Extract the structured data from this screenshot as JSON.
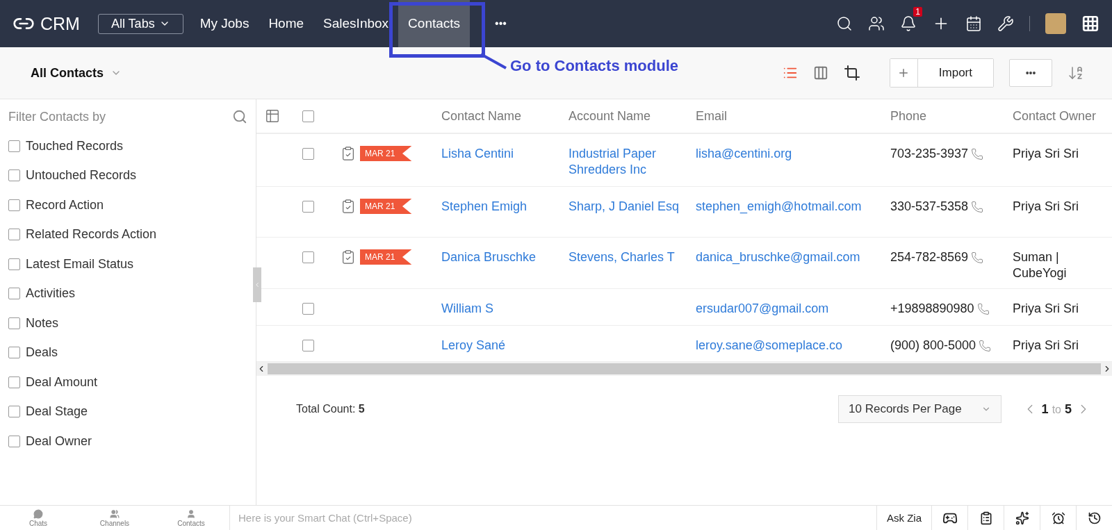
{
  "nav": {
    "logo": "CRM",
    "all_tabs": "All Tabs",
    "tabs": [
      {
        "label": "My Jobs",
        "selected": false
      },
      {
        "label": "Home",
        "selected": false
      },
      {
        "label": "SalesInbox",
        "selected": false
      },
      {
        "label": "Contacts",
        "selected": true
      }
    ],
    "more": "•••",
    "notification_count": "1"
  },
  "annotation": {
    "text": "Go to Contacts module"
  },
  "toolbar": {
    "view": "All Contacts",
    "view_modes": [
      {
        "kind": "list",
        "selected": true
      },
      {
        "kind": "kanban",
        "selected": false
      }
    ],
    "import": "Import",
    "more": "•••"
  },
  "sidebar": {
    "title": "Filter Contacts by",
    "filters": [
      {
        "label": "Touched Records",
        "checked": false
      },
      {
        "label": "Untouched Records",
        "checked": false
      },
      {
        "label": "Record Action",
        "checked": false
      },
      {
        "label": "Related Records Action",
        "checked": false
      },
      {
        "label": "Latest Email Status",
        "checked": false
      },
      {
        "label": "Activities",
        "checked": false
      },
      {
        "label": "Notes",
        "checked": false
      },
      {
        "label": "Deals",
        "checked": false
      },
      {
        "label": "Deal Amount",
        "checked": false
      },
      {
        "label": "Deal Stage",
        "checked": false
      },
      {
        "label": "Deal Owner",
        "checked": false
      }
    ]
  },
  "table": {
    "select_all_checked": false,
    "columns": [
      "Contact Name",
      "Account Name",
      "Email",
      "Phone",
      "Contact Owner"
    ],
    "rows": [
      {
        "checked": false,
        "has_task": true,
        "tag": "MAR 21",
        "contact_name": "Lisha Centini",
        "account_name": "Industrial Paper Shredders Inc",
        "email": "lisha@centini.org",
        "phone": "703-235-3937",
        "owner": "Priya Sri Sri"
      },
      {
        "checked": false,
        "has_task": true,
        "tag": "MAR 21",
        "contact_name": "Stephen Emigh",
        "account_name": "Sharp, J Daniel Esq",
        "email": "stephen_emigh@hotmail.com",
        "phone": "330-537-5358",
        "owner": "Priya Sri Sri"
      },
      {
        "checked": false,
        "has_task": true,
        "tag": "MAR 21",
        "contact_name": "Danica Bruschke",
        "account_name": "Stevens, Charles T",
        "email": "danica_bruschke@gmail.com",
        "phone": "254-782-8569",
        "owner": "Suman | CubeYogi"
      },
      {
        "checked": false,
        "has_task": false,
        "contact_name": "William S",
        "email": "ersudar007@gmail.com",
        "phone": "+19898890980",
        "owner": "Priya Sri Sri"
      },
      {
        "checked": false,
        "has_task": false,
        "contact_name": "Leroy Sané",
        "email": "leroy.sane@someplace.co",
        "phone": "(900) 800-5000",
        "owner": "Priya Sri Sri"
      }
    ]
  },
  "footer": {
    "total_label": "Total Count:",
    "total": "5",
    "per_page": "10 Records Per Page",
    "range_start": "1",
    "range_word": "to",
    "range_end": "5"
  },
  "bottom_bar": {
    "items": [
      "Chats",
      "Channels",
      "Contacts"
    ],
    "chat_placeholder": "Here is your Smart Chat (Ctrl+Space)",
    "ask_zia": "Ask Zia"
  }
}
